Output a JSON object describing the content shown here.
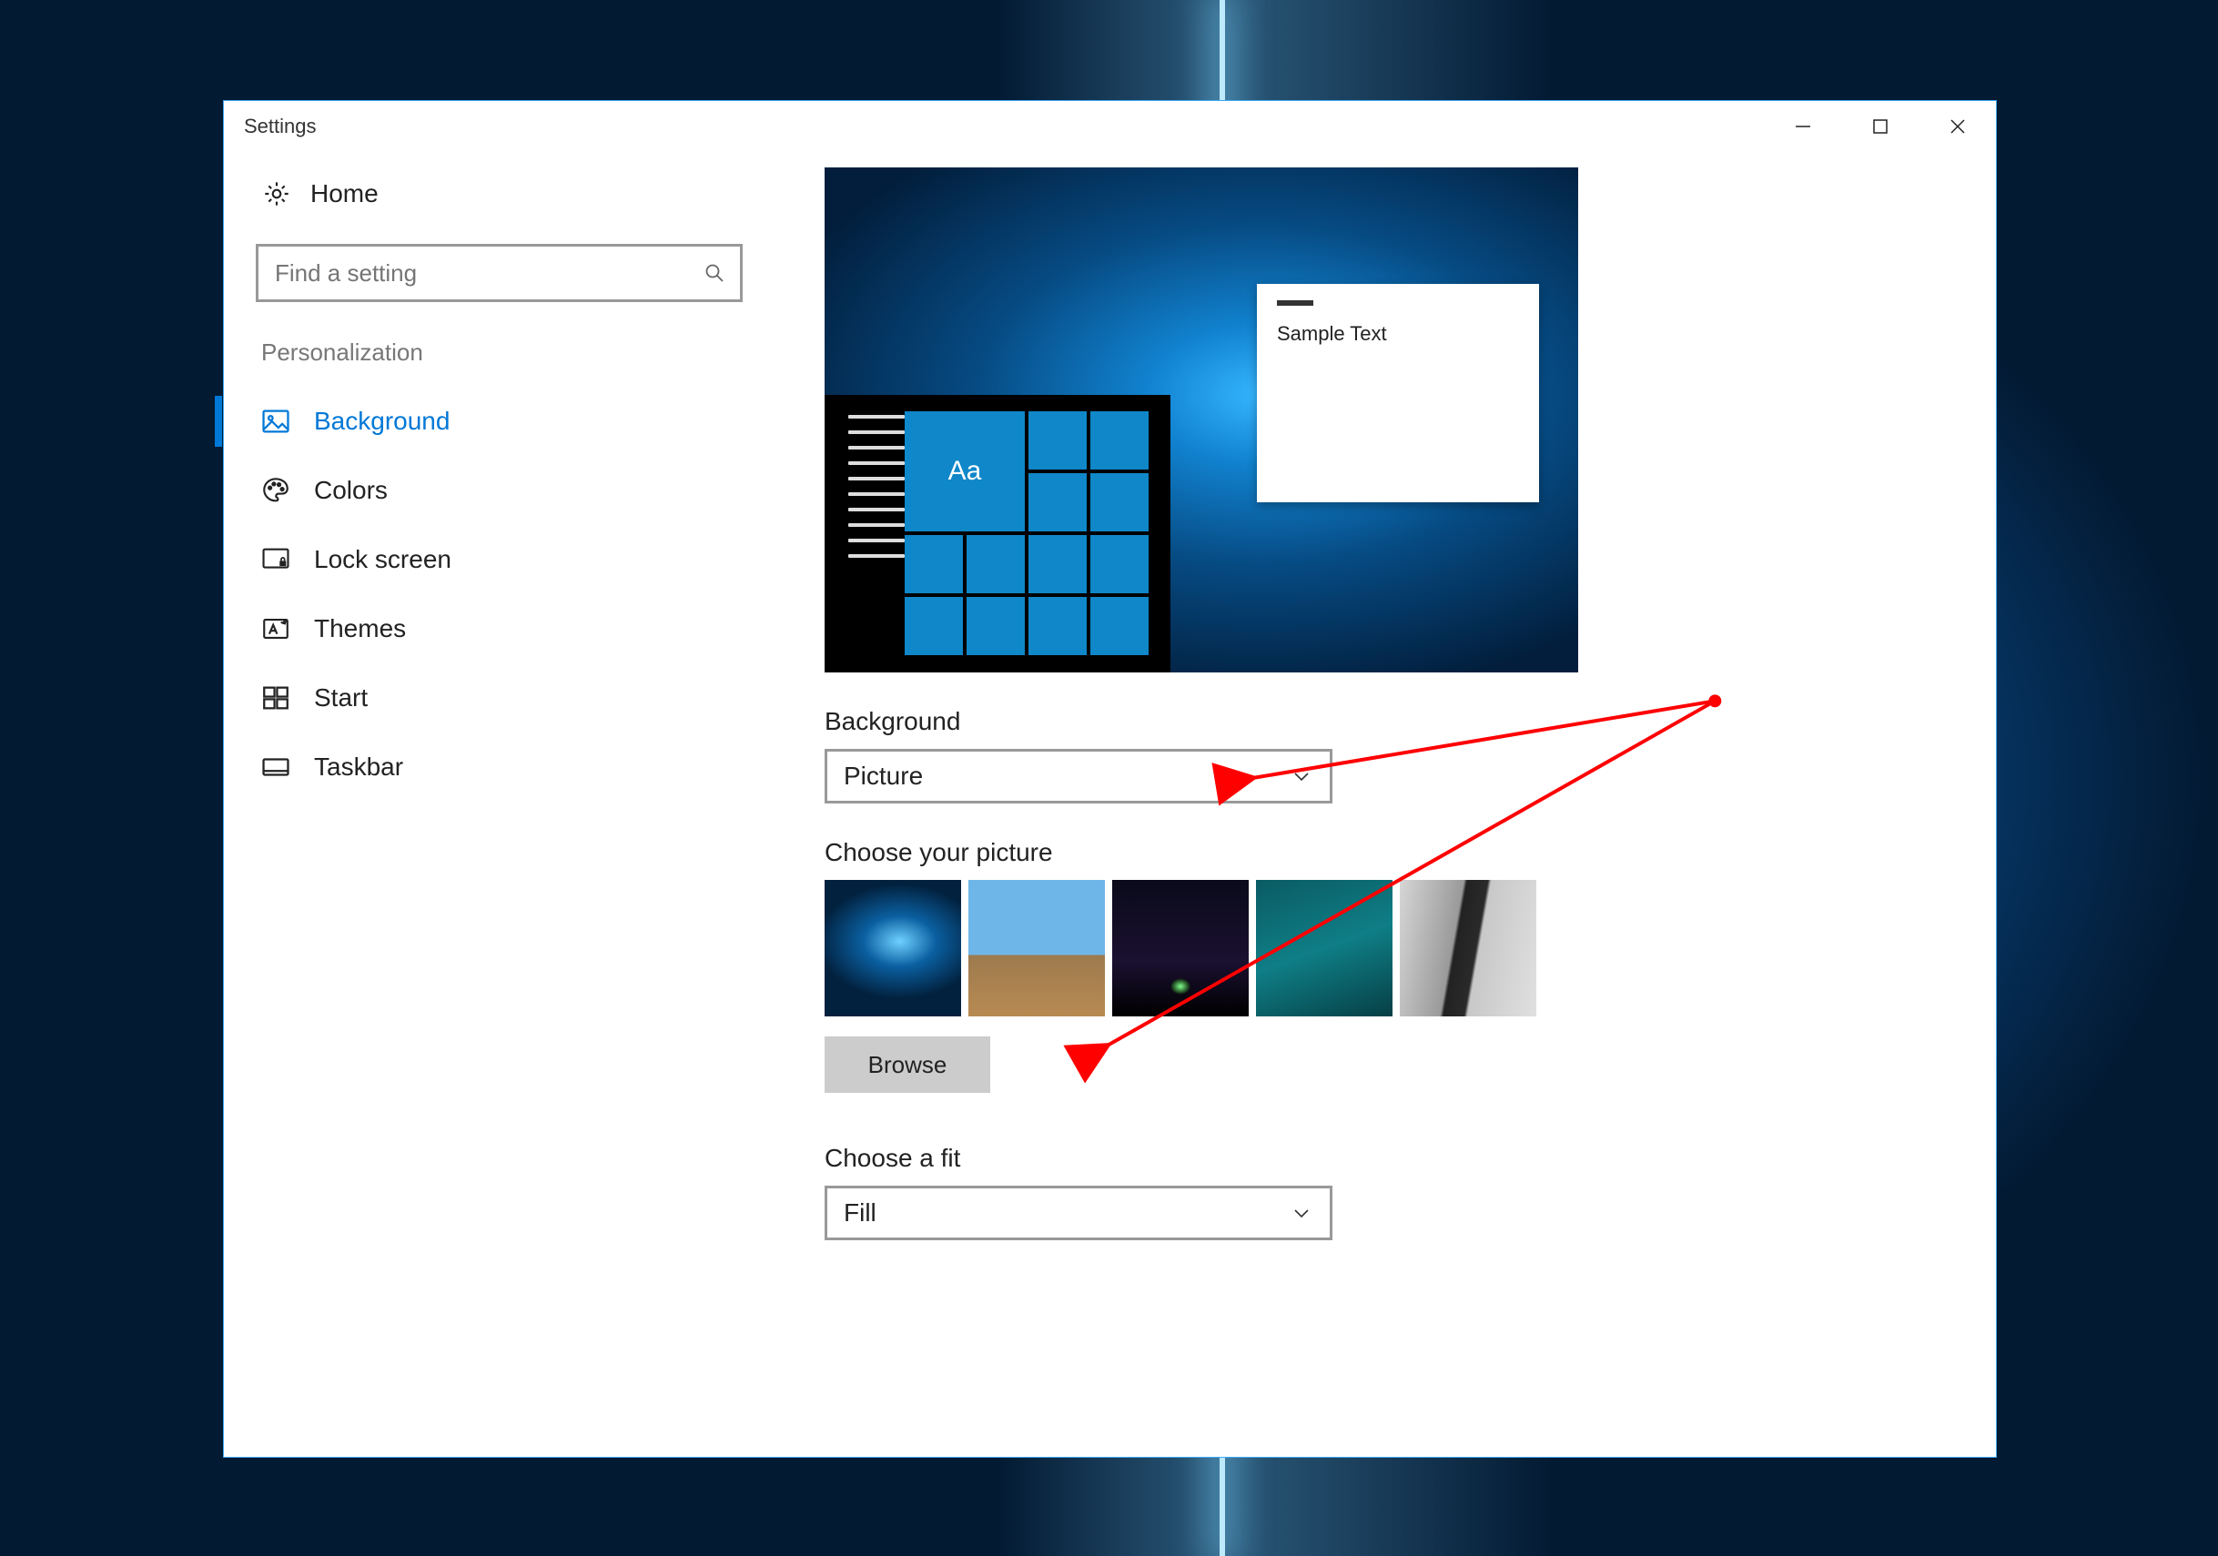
{
  "window": {
    "title": "Settings"
  },
  "sidebar": {
    "home": "Home",
    "search_placeholder": "Find a setting",
    "section": "Personalization",
    "items": [
      {
        "label": "Background"
      },
      {
        "label": "Colors"
      },
      {
        "label": "Lock screen"
      },
      {
        "label": "Themes"
      },
      {
        "label": "Start"
      },
      {
        "label": "Taskbar"
      }
    ]
  },
  "content": {
    "preview_sample": "Sample Text",
    "preview_tile": "Aa",
    "background_label": "Background",
    "background_value": "Picture",
    "choose_picture_label": "Choose your picture",
    "browse_label": "Browse",
    "fit_label": "Choose a fit",
    "fit_value": "Fill"
  }
}
